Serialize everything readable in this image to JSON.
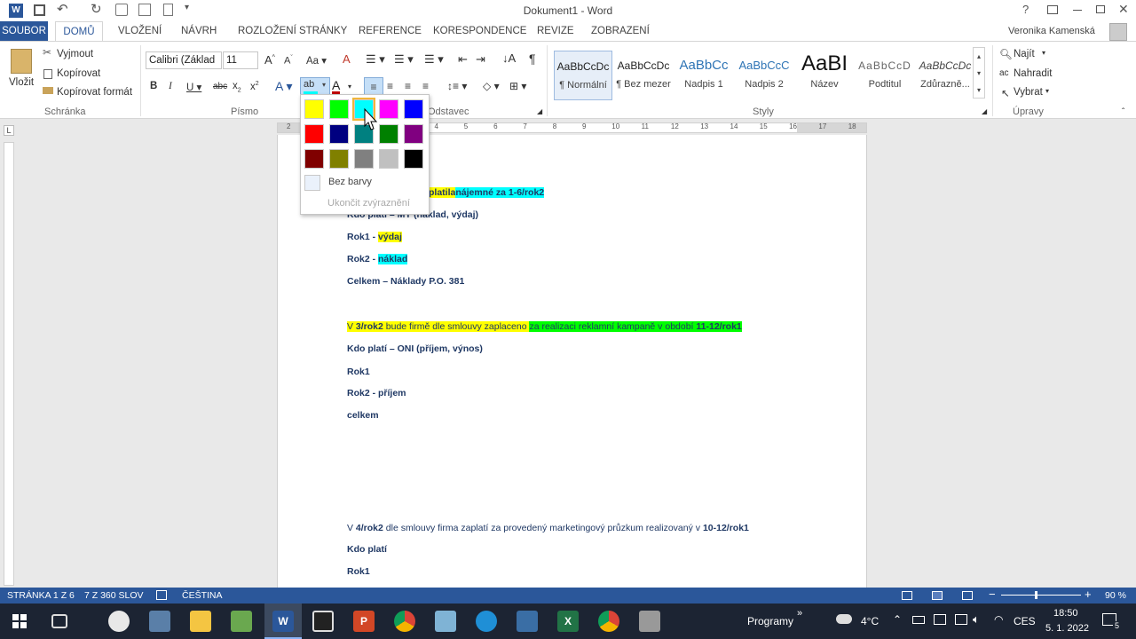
{
  "title": "Dokument1 - Word",
  "user": "Veronika Kamenská",
  "tabs": [
    "SOUBOR",
    "DOMŮ",
    "VLOŽENÍ",
    "NÁVRH",
    "ROZLOŽENÍ STRÁNKY",
    "REFERENCE",
    "KORESPONDENCE",
    "REVIZE",
    "ZOBRAZENÍ"
  ],
  "clipboard": {
    "paste": "Vložit",
    "cut": "Vyjmout",
    "copy": "Kopírovat",
    "format": "Kopírovat formát",
    "label": "Schránka"
  },
  "font": {
    "name": "Calibri (Základ",
    "size": "11",
    "label": "Písmo"
  },
  "paragraph_label": "Odstavec",
  "styles": {
    "label": "Styly",
    "items": [
      {
        "preview": "AaBbCcDc",
        "name": "¶ Normální"
      },
      {
        "preview": "AaBbCcDc",
        "name": "¶ Bez mezer"
      },
      {
        "preview": "AaBbCc",
        "name": "Nadpis 1"
      },
      {
        "preview": "AaBbCcC",
        "name": "Nadpis 2"
      },
      {
        "preview": "AaBI",
        "name": "Název"
      },
      {
        "preview": "AaBbCcD",
        "name": "Podtitul"
      },
      {
        "preview": "AaBbCcDc",
        "name": "Zdůrazně..."
      }
    ]
  },
  "editing": {
    "find": "Najít",
    "replace": "Nahradit",
    "select": "Vybrat",
    "label": "Úpravy"
  },
  "highlight_menu": {
    "colors": [
      "#ffff00",
      "#00ff00",
      "#00ffff",
      "#ff00ff",
      "#0000ff",
      "#ff0000",
      "#000080",
      "#008080",
      "#008000",
      "#800080",
      "#800000",
      "#808000",
      "#808080",
      "#c0c0c0",
      "#000000"
    ],
    "no_color": "Bez barvy",
    "stop": "Ukončit zvýraznění"
  },
  "ruler": [
    "2",
    "1",
    "1",
    "2",
    "3",
    "4",
    "5",
    "6",
    "7",
    "8",
    "9",
    "10",
    "11",
    "12",
    "13",
    "14",
    "15",
    "16",
    "17",
    "18"
  ],
  "doc": {
    "p1a": "platila",
    "p1b": "nájemné za ",
    "p1c": "1-6/rok2",
    "p2": "Kdo platí – MY (náklad, výdaj)",
    "p3a": "Rok1 - ",
    "p3b": "výdaj",
    "p4a": "Rok2 - ",
    "p4b": "náklad",
    "p5": "Celkem – Náklady P.O. 381",
    "p6a": "V ",
    "p6b": "3/rok2",
    "p6c": " bude firmě dle smlouvy zaplaceno ",
    "p6d": "za realizaci reklamní kampaně v období ",
    "p6e": "11-12/rok1",
    "p7": "Kdo platí – ONI (příjem, výnos)",
    "p8": "Rok1",
    "p9": "Rok2 - příjem",
    "p10": "celkem",
    "p11a": "V ",
    "p11b": "4/rok2",
    "p11c": " dle smlouvy firma zaplatí za provedený marketingový průzkum realizovaný v ",
    "p11d": "10-12/rok1",
    "p12": "Kdo platí",
    "p13": "Rok1"
  },
  "status": {
    "page": "STRÁNKA 1 Z 6",
    "words": "7 Z 360 SLOV",
    "lang": "ČEŠTINA",
    "zoom": "90 %"
  },
  "taskbar": {
    "programs": "Programy",
    "temp": "4°C",
    "lang": "CES",
    "time": "18:50",
    "date": "5. 1. 2022",
    "notif": "5"
  }
}
